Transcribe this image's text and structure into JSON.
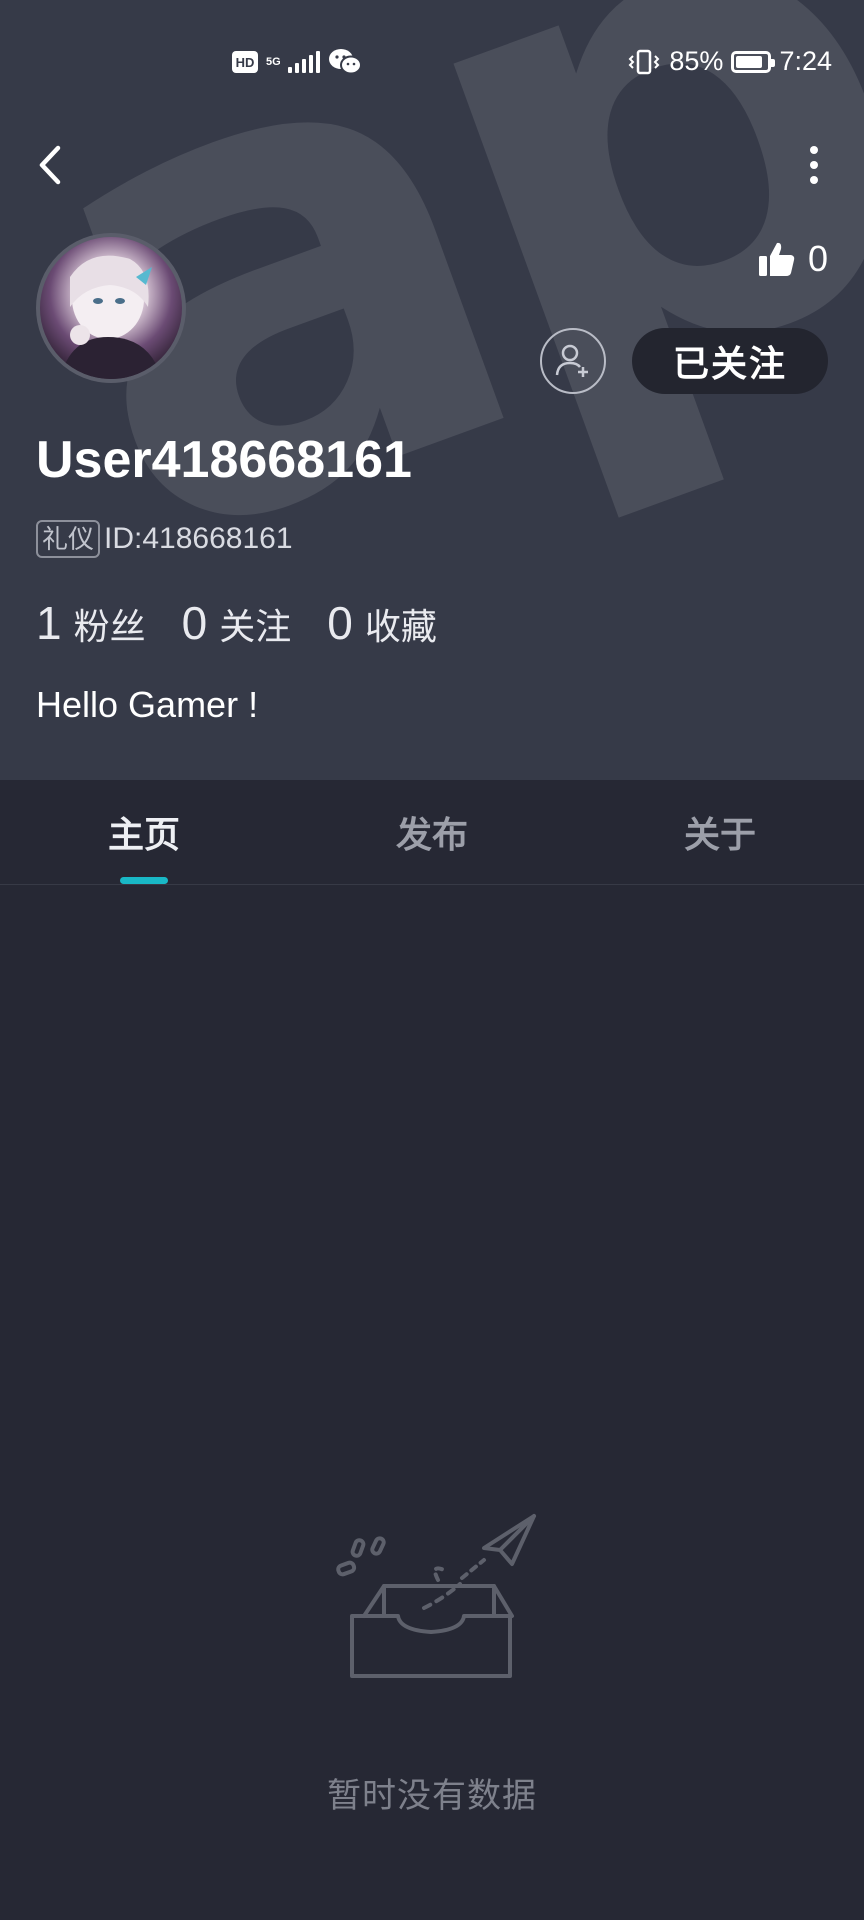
{
  "status_bar": {
    "hd": "HD",
    "network": "5G",
    "battery_percent": "85%",
    "battery_level": 0.85,
    "time": "7:24",
    "icons": [
      "hd-icon",
      "signal-icon",
      "wechat-icon",
      "vibrate-icon",
      "battery-icon"
    ]
  },
  "nav": {
    "back_icon": "chevron-left-icon",
    "more_icon": "more-vertical-icon"
  },
  "profile": {
    "username": "User418668161",
    "tag": "礼仪",
    "id_text": "ID:418668161",
    "likes": "0",
    "follow_button": "已关注",
    "bio": "Hello Gamer !",
    "stats": [
      {
        "value": "1",
        "label": "粉丝"
      },
      {
        "value": "0",
        "label": "关注"
      },
      {
        "value": "0",
        "label": "收藏"
      }
    ]
  },
  "tabs": [
    {
      "label": "主页",
      "active": true
    },
    {
      "label": "发布",
      "active": false
    },
    {
      "label": "关于",
      "active": false
    }
  ],
  "empty_state": {
    "text": "暂时没有数据",
    "icon": "empty-inbox-icon"
  },
  "colors": {
    "header_bg": "#363a48",
    "page_bg": "#262834",
    "accent": "#19b8c6",
    "follow_btn_bg": "#23252f"
  }
}
